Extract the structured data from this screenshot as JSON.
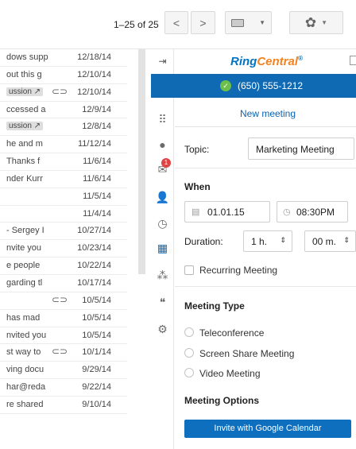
{
  "toolbar": {
    "pager_text": "1–25 of 25",
    "prev_icon": "chevron-left",
    "next_icon": "chevron-right",
    "keyboard_icon": "keyboard",
    "settings_icon": "gear"
  },
  "mail": {
    "rows": [
      {
        "snippet": "dows supp",
        "date": "12/18/14"
      },
      {
        "snippet": "out this g",
        "date": "12/10/14"
      },
      {
        "snippet": "ussion ↗",
        "date": "12/10/14",
        "tag": true,
        "clip": true
      },
      {
        "snippet": "ccessed a",
        "date": "12/9/14"
      },
      {
        "snippet": "ussion ↗",
        "date": "12/8/14",
        "tag": true
      },
      {
        "snippet": "he and m",
        "date": "11/12/14"
      },
      {
        "snippet": "Thanks f",
        "date": "11/6/14"
      },
      {
        "snippet": "nder Kurr",
        "date": "11/6/14"
      },
      {
        "snippet": "",
        "date": "11/5/14"
      },
      {
        "snippet": "",
        "date": "11/4/14"
      },
      {
        "snippet": "- Sergey I",
        "date": "10/27/14"
      },
      {
        "snippet": "nvite you",
        "date": "10/23/14"
      },
      {
        "snippet": "e people",
        "date": "10/22/14"
      },
      {
        "snippet": "garding tl",
        "date": "10/17/14"
      },
      {
        "snippet": "",
        "date": "10/5/14",
        "clip": true
      },
      {
        "snippet": "has mad",
        "date": "10/5/14"
      },
      {
        "snippet": "nvited you",
        "date": "10/5/14"
      },
      {
        "snippet": "st way to",
        "date": "10/1/14",
        "clip": true
      },
      {
        "snippet": "ving docu",
        "date": "9/29/14"
      },
      {
        "snippet": "har@reda",
        "date": "9/22/14"
      },
      {
        "snippet": "re shared",
        "date": "9/10/14"
      }
    ]
  },
  "rc": {
    "brand_left": "Ring",
    "brand_right": "Central",
    "brand_mark": "®",
    "phone": "(650) 555-1212",
    "header_title": "New meeting",
    "topic_label": "Topic:",
    "topic_value": "Marketing Meeting",
    "when_label": "When",
    "date_value": "01.01.15",
    "time_value": "08:30PM",
    "duration_label": "Duration:",
    "hours_value": "1 h.",
    "minutes_value": "00 m.",
    "recurring_label": "Recurring Meeting",
    "meeting_type_label": "Meeting Type",
    "types": [
      "Teleconference",
      "Screen Share Meeting",
      "Video Meeting"
    ],
    "options_label": "Meeting Options",
    "invite_button": "Invite with Google Calendar",
    "badge_count": "1",
    "colors": {
      "brand_blue": "#0f6ab3",
      "brand_orange": "#f4821f",
      "status_green": "#6cc04a",
      "badge_red": "#e04343"
    }
  }
}
